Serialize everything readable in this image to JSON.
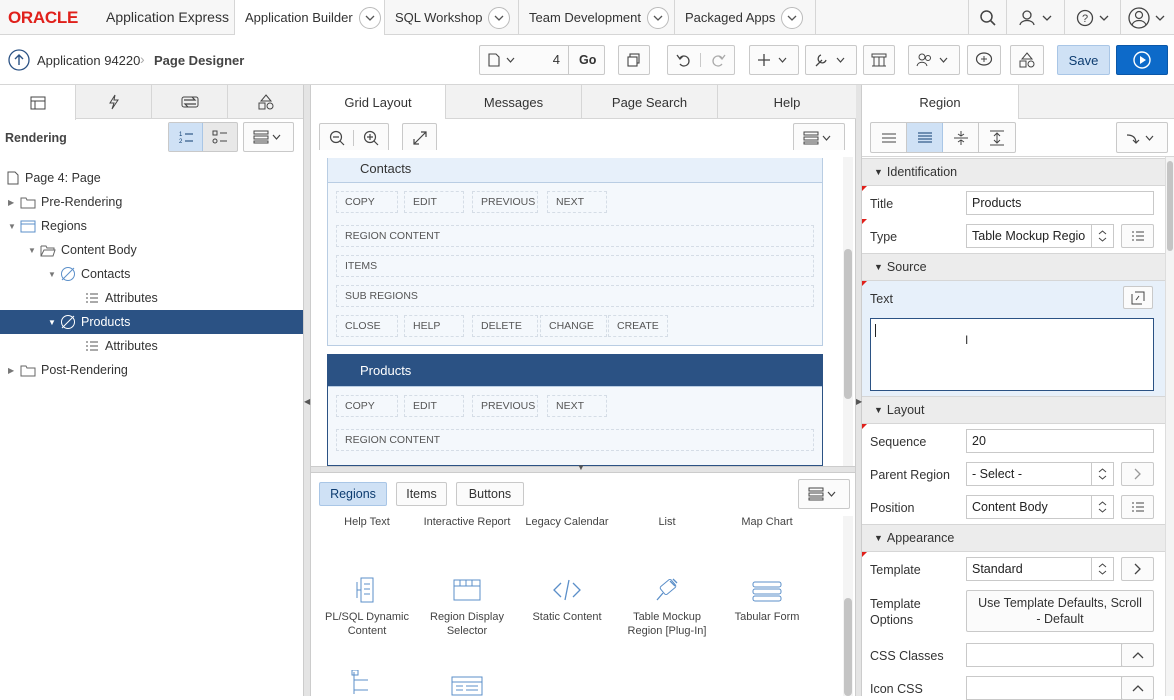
{
  "header": {
    "brand_oracle": "ORACLE",
    "brand_app": "Application Express",
    "tabs": [
      {
        "label": "Application Builder"
      },
      {
        "label": "SQL Workshop"
      },
      {
        "label": "Team Development"
      },
      {
        "label": "Packaged Apps"
      }
    ]
  },
  "toolbar": {
    "app_label": "Application 94220",
    "page_designer_label": "Page Designer",
    "page_number": "4",
    "go_label": "Go",
    "save_label": "Save"
  },
  "left": {
    "rendering_label": "Rendering",
    "tree": [
      {
        "label": "Page 4: Page"
      },
      {
        "label": "Pre-Rendering"
      },
      {
        "label": "Regions"
      },
      {
        "label": "Content Body"
      },
      {
        "label": "Contacts"
      },
      {
        "label": "Attributes"
      },
      {
        "label": "Products"
      },
      {
        "label": "Attributes"
      },
      {
        "label": "Post-Rendering"
      }
    ]
  },
  "center": {
    "tabs": [
      {
        "label": "Grid Layout"
      },
      {
        "label": "Messages"
      },
      {
        "label": "Page Search"
      },
      {
        "label": "Help"
      }
    ],
    "contacts_region": {
      "title": "Contacts",
      "top_buttons": [
        "COPY",
        "EDIT",
        "PREVIOUS",
        "NEXT"
      ],
      "rows": [
        "REGION CONTENT",
        "ITEMS",
        "SUB REGIONS"
      ],
      "bottom_buttons": [
        "CLOSE",
        "HELP",
        "DELETE",
        "CHANGE",
        "CREATE"
      ]
    },
    "products_region": {
      "title": "Products",
      "top_buttons": [
        "COPY",
        "EDIT",
        "PREVIOUS",
        "NEXT"
      ],
      "rows": [
        "REGION CONTENT"
      ]
    },
    "gallery_tabs": [
      {
        "label": "Regions"
      },
      {
        "label": "Items"
      },
      {
        "label": "Buttons"
      }
    ],
    "gallery_top_labels": [
      "Help Text",
      "Interactive Report",
      "Legacy Calendar",
      "List",
      "Map Chart"
    ],
    "gallery_items": [
      {
        "label": "PL/SQL Dynamic Content",
        "icon": "plsql-icon"
      },
      {
        "label": "Region Display Selector",
        "icon": "region-selector-icon"
      },
      {
        "label": "Static Content",
        "icon": "code-icon"
      },
      {
        "label": "Table Mockup Region [Plug-In]",
        "icon": "plug-icon"
      },
      {
        "label": "Tabular Form",
        "icon": "tabular-form-icon"
      }
    ]
  },
  "right": {
    "header_tab": "Region",
    "sections": {
      "identification": "Identification",
      "source": "Source",
      "layout": "Layout",
      "appearance": "Appearance"
    },
    "fields": {
      "title_label": "Title",
      "title_value": "Products",
      "type_label": "Type",
      "type_value": "Table Mockup Regio",
      "text_label": "Text",
      "text_value": "",
      "sequence_label": "Sequence",
      "sequence_value": "20",
      "parent_label": "Parent Region",
      "parent_value": "- Select -",
      "position_label": "Position",
      "position_value": "Content Body",
      "template_label": "Template",
      "template_value": "Standard",
      "template_options_label": "Template Options",
      "template_options_value": "Use Template Defaults, Scroll - Default",
      "css_classes_label": "CSS Classes",
      "icon_css_label": "Icon CSS"
    }
  },
  "colors": {
    "oracle_red": "#e0201b",
    "selection_blue": "#2b5284",
    "save_bg": "#cfe1f5",
    "run_bg": "#0d6ac9"
  }
}
